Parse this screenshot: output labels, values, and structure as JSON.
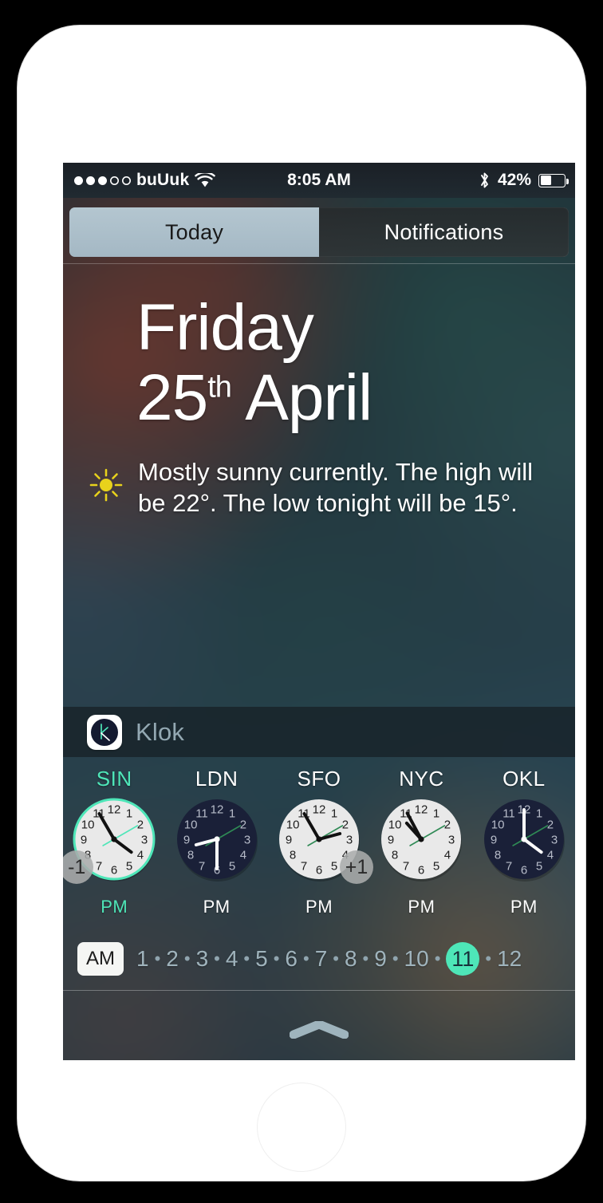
{
  "status_bar": {
    "signal_dots_filled": 3,
    "signal_dots_total": 5,
    "carrier": "buUuk",
    "wifi_icon": "wifi-icon",
    "time": "8:05 AM",
    "bluetooth_icon": "bluetooth-icon",
    "battery_percent": "42%",
    "battery_level": 42
  },
  "tabs": {
    "today": "Today",
    "notifications": "Notifications",
    "active": "Today"
  },
  "date": {
    "weekday": "Friday",
    "day_number": "25",
    "day_suffix": "th",
    "month": "April"
  },
  "weather": {
    "icon": "sun-icon",
    "icon_color": "#e8d21c",
    "summary": "Mostly sunny currently. The high will be 22°. The low tonight will be 15°.",
    "high": "22°",
    "low": "15°"
  },
  "klok": {
    "app_icon": "klok-app-icon",
    "title": "Klok",
    "accent_color": "#4ee6b8",
    "clocks": [
      {
        "city": "SIN",
        "accent": true,
        "face": "light",
        "ring": "#4ee6b8",
        "offset_badge": "-1",
        "badge_side": "left",
        "ampm": "PM",
        "hour_deg": 127,
        "minute_deg": 330,
        "second_deg": 60
      },
      {
        "city": "LDN",
        "accent": false,
        "face": "dark",
        "ring": "none",
        "offset_badge": "",
        "badge_side": "",
        "ampm": "PM",
        "hour_deg": 255,
        "minute_deg": 180,
        "second_deg": 60
      },
      {
        "city": "SFO",
        "accent": false,
        "face": "light",
        "ring": "none",
        "offset_badge": "+1",
        "badge_side": "right",
        "ampm": "PM",
        "hour_deg": 75,
        "minute_deg": 330,
        "second_deg": 60
      },
      {
        "city": "NYC",
        "accent": false,
        "face": "light",
        "ring": "none",
        "offset_badge": "",
        "badge_side": "",
        "ampm": "PM",
        "hour_deg": 318,
        "minute_deg": 332,
        "second_deg": 60
      },
      {
        "city": "OKL",
        "accent": false,
        "face": "dark",
        "ring": "none",
        "offset_badge": "",
        "badge_side": "",
        "ampm": "PM",
        "hour_deg": 127,
        "minute_deg": 0,
        "second_deg": 60
      }
    ],
    "timeline": {
      "ampm_chip": "AM",
      "hours": [
        "1",
        "2",
        "3",
        "4",
        "5",
        "6",
        "7",
        "8",
        "9",
        "10",
        "11",
        "12"
      ],
      "separator": "•",
      "selected_hour": "11"
    }
  },
  "home_indicator": {
    "grabber_icon": "chevron-up-grabber"
  }
}
